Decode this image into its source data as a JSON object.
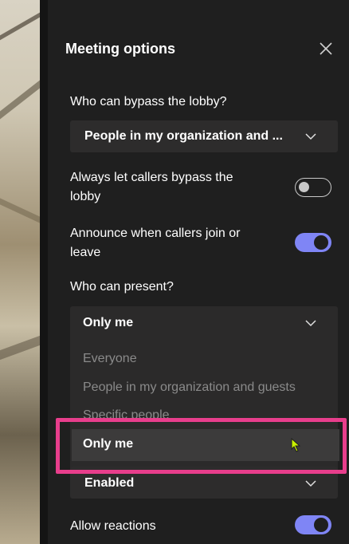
{
  "panel": {
    "title": "Meeting options",
    "lobby": {
      "label": "Who can bypass the lobby?",
      "value": "People in my organization and ..."
    },
    "callers_bypass": {
      "label_line1": "Always let callers bypass the",
      "label_line2": "lobby",
      "enabled": false
    },
    "announce": {
      "label_line1": "Announce when callers join or",
      "label_line2": "leave",
      "enabled": true
    },
    "present": {
      "label": "Who can present?",
      "value": "Only me",
      "options": [
        "Everyone",
        "People in my organization and guests",
        "Specific people",
        "Only me"
      ]
    },
    "next_dropdown": {
      "value": "Enabled"
    },
    "reactions": {
      "label": "Allow reactions",
      "enabled": true
    }
  },
  "colors": {
    "toggle_on": "#7f85f5",
    "highlight": "#e83e8c",
    "background": "#1f1f1f"
  },
  "icons": {
    "close": "close-icon",
    "chevron": "chevron-down-icon",
    "cursor": "mouse-pointer-icon"
  }
}
